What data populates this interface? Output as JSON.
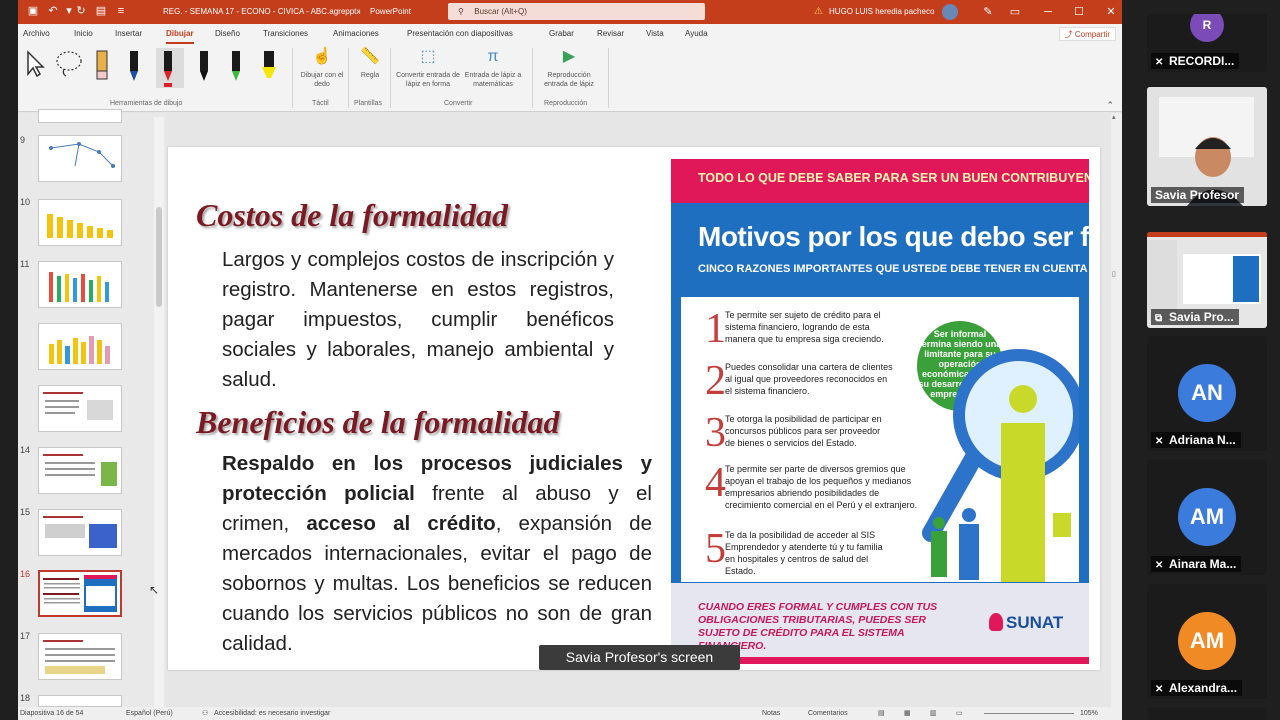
{
  "titlebar": {
    "filename": "REG. - SEMANA 17 - ECONO - CIVICA - ABC.agreppt",
    "filename_display": "REG. - SEMANA 17 - ECONO - CIVICA - ABC.agrepptx",
    "separator": "-",
    "app": "PowerPoint",
    "search_placeholder": "Buscar (Alt+Q)",
    "warning_icon": "⚠",
    "user": "HUGO LUIS heredia pacheco"
  },
  "menu": {
    "items": [
      "Archivo",
      "Inicio",
      "Insertar",
      "Dibujar",
      "Diseño",
      "Transiciones",
      "Animaciones",
      "Presentación con diapositivas",
      "Grabar",
      "Revisar",
      "Vista",
      "Ayuda"
    ],
    "active": "Dibujar",
    "share": "Compartir"
  },
  "ribbon": {
    "group_tools": "Herramientas de dibujo",
    "touch_btn": "Dibujar con el dedo",
    "group_touch": "Táctil",
    "ruler_btn": "Regla",
    "group_stencils": "Plantillas",
    "ink_shape_btn": "Convertir entrada de lápiz en forma",
    "ink_math_btn": "Entrada de lápiz a matemáticas",
    "group_convert": "Convertir",
    "replay_btn": "Reproducción entrada de lápiz",
    "group_replay": "Reproducción"
  },
  "thumbnails": {
    "numbers": [
      "9",
      "10",
      "11",
      "13",
      "14",
      "15",
      "16",
      "17",
      "18"
    ],
    "active": "16"
  },
  "slide": {
    "heading1": "Costos de la formalidad",
    "para1": "Largos y complejos costos de inscripción y registro. Mantenerse en estos registros, pagar impuestos, cumplir benéficos sociales y laborales, manejo ambiental y salud.",
    "heading2": "Beneficios de la formalidad",
    "para2_bold1": "Respaldo en los procesos judiciales y protección policial",
    "para2_text1": " frente al abuso y el crimen, ",
    "para2_bold2": "acceso al crédito",
    "para2_text2": ", expansión de mercados internacionales, evitar el pago de sobornos y multas. Los beneficios se reducen cuando los servicios públicos no son de gran calidad."
  },
  "infographic": {
    "banner": "TODO LO QUE DEBE SABER PARA SER UN BUEN CONTRIBUYENTE",
    "title": "Motivos por los que debo ser formal",
    "subtitle": "CINCO RAZONES IMPORTANTES QUE USTEDE DEBE TENER EN CUENTA",
    "reasons": [
      {
        "num": "1",
        "text": "Te permite ser sujeto de crédito para el sistema financiero, logrando de esta manera que tu empresa siga creciendo."
      },
      {
        "num": "2",
        "text": "Puedes consolidar una cartera de clientes al igual que proveedores reconocidos en el sistema financiero."
      },
      {
        "num": "3",
        "text": "Te otorga la posibilidad de participar en concursos públicos para ser proveedor de bienes o servicios del Estado."
      },
      {
        "num": "4",
        "text": "Te permite ser parte de diversos gremios que apoyan el trabajo de los pequeños y medianos empresarios abriendo posibilidades de crecimiento comercial en el Perú y el extranjero."
      },
      {
        "num": "5",
        "text": "Te da la posibilidad de acceder al SIS Emprendedor y atenderte tú y tu familia en hospitales y centros de salud del Estado."
      }
    ],
    "bubble": "Ser informal termina siendo una limitante para su operación económica y para su desarrollo como emprendedor.",
    "footer": "CUANDO ERES FORMAL Y CUMPLES CON TUS OBLIGACIONES TRIBUTARIAS, PUEDES SER SUJETO DE CRÉDITO PARA EL SISTEMA FINANCIERO.",
    "logo": "SUNAT"
  },
  "screen_label": "Savia Profesor's screen",
  "status": {
    "slide": "Diapositiva 16 de 54",
    "language": "Español (Perú)",
    "accessibility": "Accesibilidad: es necesario investigar",
    "notes": "Notas",
    "comments": "Comentarios",
    "zoom": "105%"
  },
  "participants": [
    {
      "name": "RECORDI...",
      "initials": "R",
      "color": "#7b4bb7"
    },
    {
      "name": "Savia Profesor",
      "initials": "",
      "color": ""
    },
    {
      "name": "Savia Pro...",
      "initials": "",
      "color": ""
    },
    {
      "name": "Adriana N...",
      "initials": "AN",
      "color": "#3b7bdc"
    },
    {
      "name": "Ainara Ma...",
      "initials": "AM",
      "color": "#3b7bdc"
    },
    {
      "name": "Alexandra...",
      "initials": "AM",
      "color": "#f08a24"
    }
  ]
}
